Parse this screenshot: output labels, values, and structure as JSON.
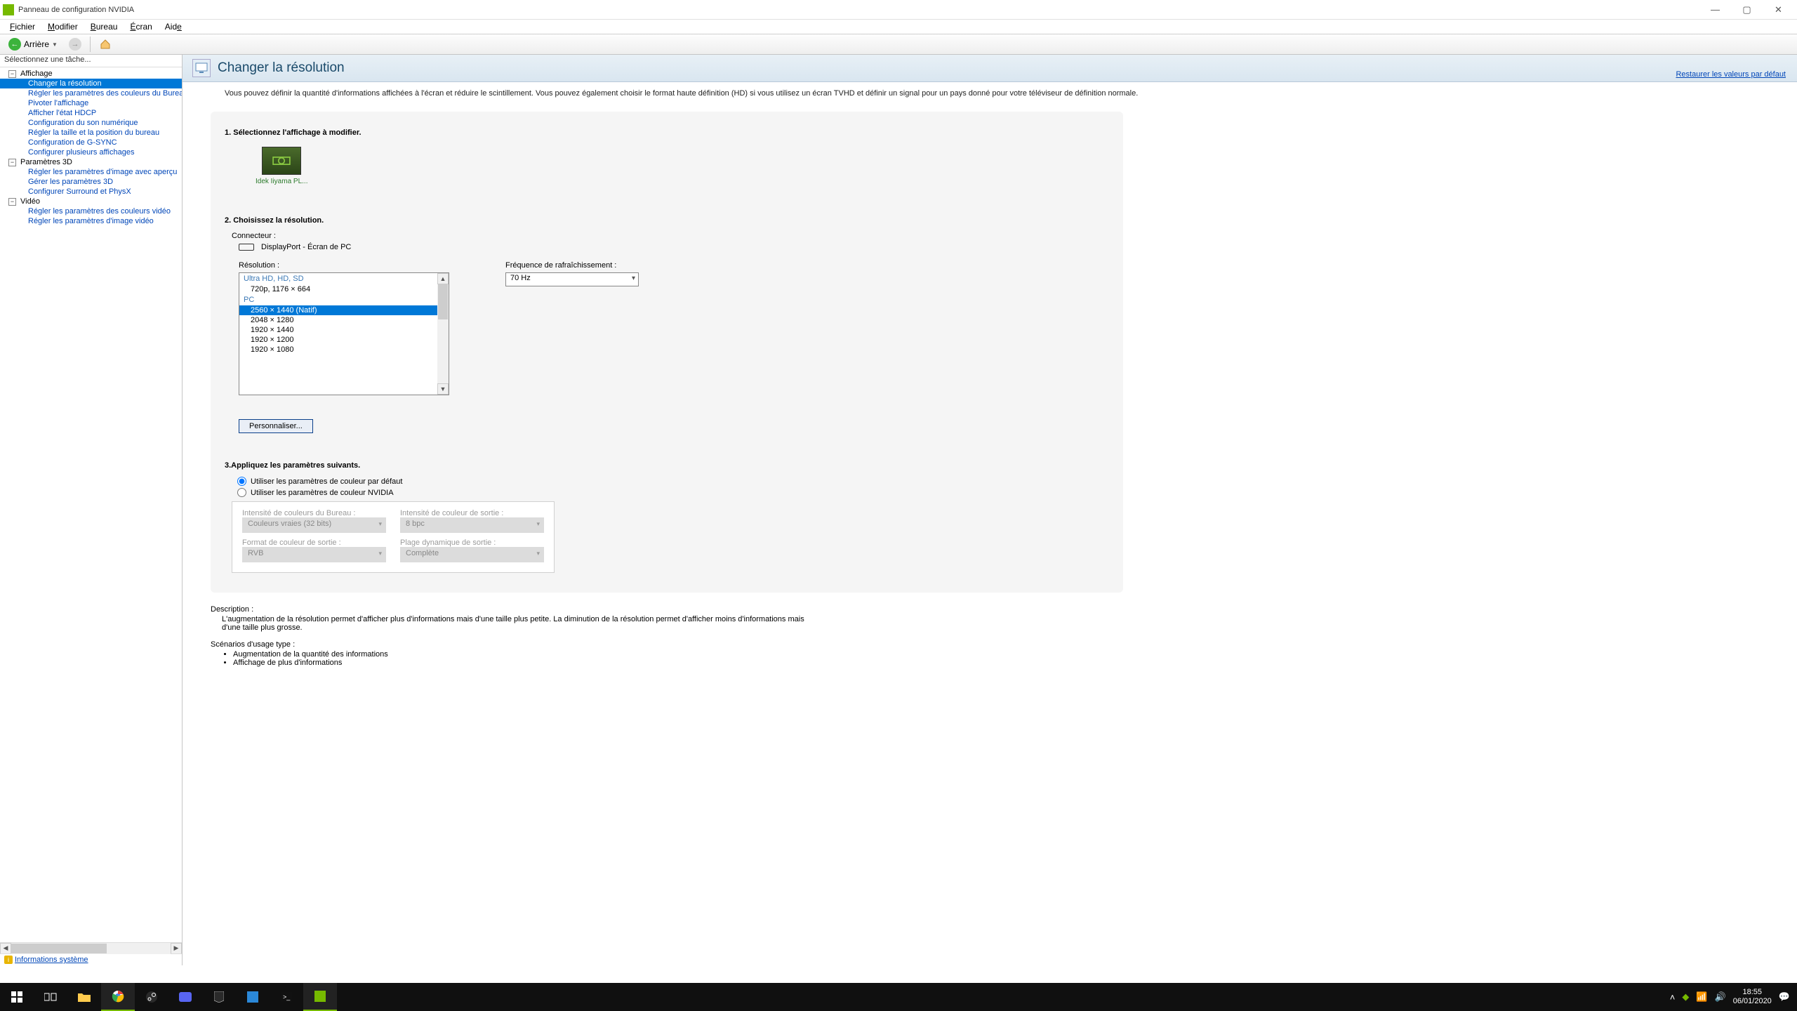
{
  "window": {
    "title": "Panneau de configuration NVIDIA"
  },
  "menu": {
    "file": "Fichier",
    "edit": "Modifier",
    "desktop": "Bureau",
    "screen": "Écran",
    "help": "Aide"
  },
  "toolbar": {
    "back": "Arrière"
  },
  "sidebar": {
    "header": "Sélectionnez une tâche...",
    "footer": "Informations système",
    "groups": [
      {
        "name": "Affichage",
        "items": [
          "Changer la résolution",
          "Régler les paramètres des couleurs du Bureau",
          "Pivoter l'affichage",
          "Afficher l'état HDCP",
          "Configuration du son numérique",
          "Régler la taille et la position du bureau",
          "Configuration de G-SYNC",
          "Configurer plusieurs affichages"
        ],
        "selected": 0
      },
      {
        "name": "Paramètres 3D",
        "items": [
          "Régler les paramètres d'image avec aperçu",
          "Gérer les paramètres 3D",
          "Configurer Surround et PhysX"
        ],
        "selected": -1
      },
      {
        "name": "Vidéo",
        "items": [
          "Régler les paramètres des couleurs vidéo",
          "Régler les paramètres d'image vidéo"
        ],
        "selected": -1
      }
    ]
  },
  "page": {
    "title": "Changer la résolution",
    "restore": "Restaurer les valeurs par défaut",
    "description": "Vous pouvez définir la quantité d'informations affichées à l'écran et réduire le scintillement. Vous pouvez également choisir le format haute définition (HD) si vous utilisez un écran TVHD et définir un signal pour un pays donné pour votre téléviseur de définition normale."
  },
  "step1": {
    "heading": "1. Sélectionnez l'affichage à modifier.",
    "display_name": "Idek Iiyama PL..."
  },
  "step2": {
    "heading": "2. Choisissez la résolution.",
    "connector_label": "Connecteur :",
    "connector_value": "DisplayPort - Écran de PC",
    "resolution_label": "Résolution :",
    "refresh_label": "Fréquence de rafraîchissement :",
    "refresh_value": "70 Hz",
    "customize": "Personnaliser...",
    "groups": [
      {
        "title": "Ultra HD, HD, SD",
        "items": [
          "720p, 1176 × 664"
        ],
        "selected": -1
      },
      {
        "title": "PC",
        "items": [
          "2560 × 1440 (Natif)",
          "2048 × 1280",
          "1920 × 1440",
          "1920 × 1200",
          "1920 × 1080"
        ],
        "selected": 0
      }
    ]
  },
  "step3": {
    "heading": "3.Appliquez les paramètres suivants.",
    "radio_default": "Utiliser les paramètres de couleur par défaut",
    "radio_nvidia": "Utiliser les paramètres de couleur NVIDIA",
    "desktop_depth_label": "Intensité de couleurs du Bureau :",
    "desktop_depth_value": "Couleurs vraies (32 bits)",
    "output_depth_label": "Intensité de couleur de sortie :",
    "output_depth_value": "8 bpc",
    "output_format_label": "Format de couleur de sortie :",
    "output_format_value": "RVB",
    "dynamic_range_label": "Plage dynamique de sortie :",
    "dynamic_range_value": "Complète"
  },
  "desc": {
    "description_h": "Description :",
    "description_b": "L'augmentation de la résolution permet d'afficher plus d'informations mais d'une taille plus petite. La diminution de la résolution permet d'afficher moins d'informations mais d'une taille plus grosse.",
    "usage_h": "Scénarios d'usage type :",
    "usage_1": "Augmentation de la quantité des informations",
    "usage_2": "Affichage de plus d'informations"
  },
  "taskbar": {
    "time": "18:55",
    "date": "06/01/2020"
  }
}
